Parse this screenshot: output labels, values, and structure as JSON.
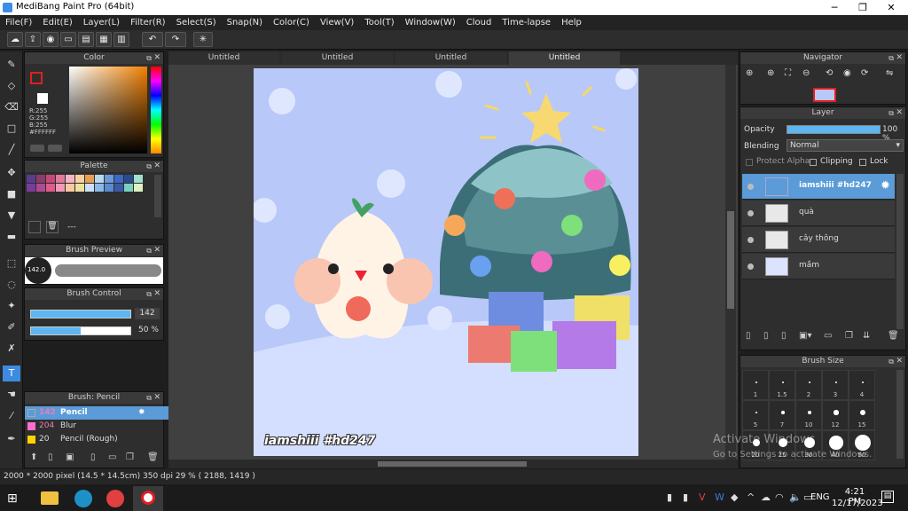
{
  "window": {
    "title": "MediBang Paint Pro (64bit)"
  },
  "menu": [
    "File(F)",
    "Edit(E)",
    "Layer(L)",
    "Filter(R)",
    "Select(S)",
    "Snap(N)",
    "Color(C)",
    "View(V)",
    "Tool(T)",
    "Window(W)",
    "Cloud",
    "Time-lapse",
    "Help"
  ],
  "tabs": [
    "Untitled",
    "Untitled",
    "Untitled",
    "Untitled"
  ],
  "color_panel": {
    "title": "Color",
    "r": "R:255",
    "g": "G:255",
    "b": "B:255",
    "hex": "#FFFFFF",
    "fg_color": "#e02020",
    "bg_color": "#ffffff"
  },
  "palette_panel": {
    "title": "Palette",
    "name": "---"
  },
  "brush_preview": {
    "title": "Brush Preview",
    "size": "142.0"
  },
  "brush_control": {
    "title": "Brush Control",
    "size": "142",
    "opacity": "50 %",
    "opacity_value": 0.5
  },
  "brush_list": {
    "title": "Brush: Pencil",
    "items": [
      {
        "size": "142",
        "name": "Pencil",
        "color": "#2b2b2b",
        "selected": true
      },
      {
        "size": "204",
        "name": "Blur",
        "color": "#ff6fcf"
      },
      {
        "size": "20",
        "name": "Pencil (Rough)",
        "color": "#ffd400"
      }
    ]
  },
  "navigator": {
    "title": "Navigator"
  },
  "layer_panel": {
    "title": "Layer",
    "opacity_label": "Opacity",
    "opacity_value": "100 %",
    "blending_label": "Blending",
    "blending_value": "Normal",
    "protect_alpha": "Protect Alpha",
    "clipping": "Clipping",
    "lock": "Lock",
    "layers": [
      {
        "name": "iamshiii #hd247",
        "selected": true
      },
      {
        "name": "quà"
      },
      {
        "name": "cây thông"
      },
      {
        "name": "mầm"
      }
    ]
  },
  "brush_size": {
    "title": "Brush Size",
    "sizes": [
      "1",
      "1.5",
      "2",
      "3",
      "4",
      "5",
      "7",
      "10",
      "12",
      "15",
      "20",
      "25",
      "30",
      "40",
      "50"
    ]
  },
  "canvas_signature": "iamshiii #hd247",
  "status": {
    "dimensions": "2000 * 2000 pixel",
    "physical": "(14.5 * 14.5cm)",
    "dpi": "350 dpi",
    "zoom": "29 %",
    "coords": "( 2188, 1419 )"
  },
  "watermark": {
    "line1": "Activate Windows",
    "line2": "Go to Settings to activate Windows."
  },
  "taskbar": {
    "lang": "ENG",
    "time": "4:21 PM",
    "date": "12/17/2023"
  }
}
